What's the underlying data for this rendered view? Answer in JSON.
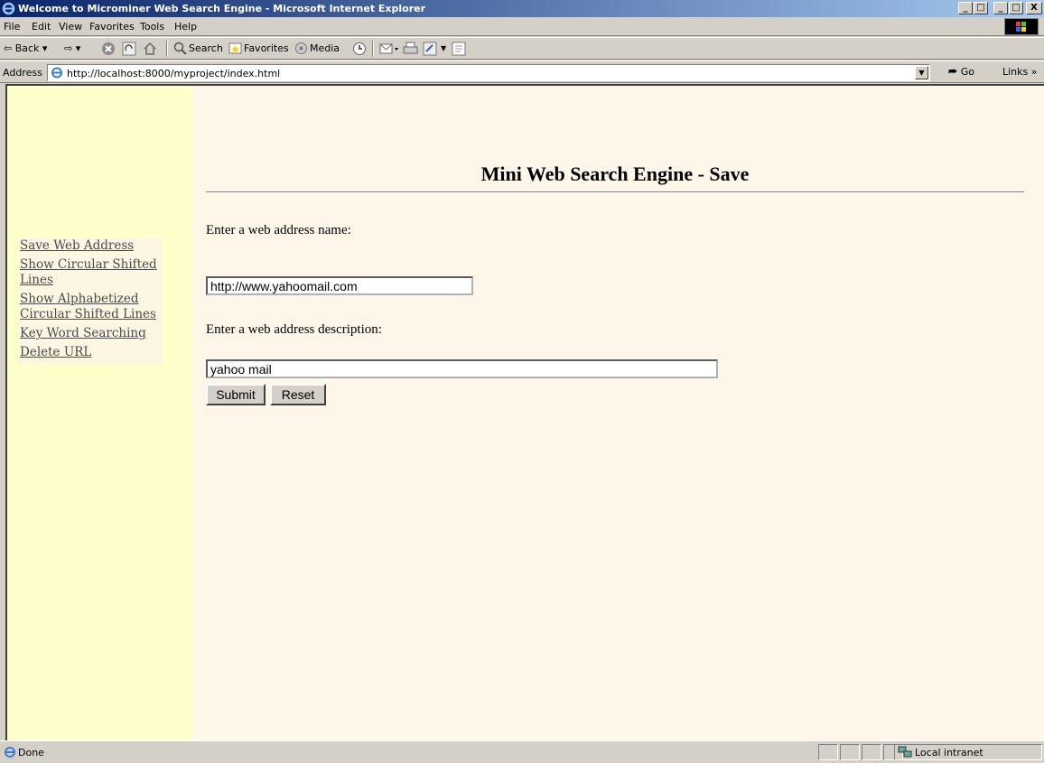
{
  "window": {
    "title": "Welcome to Microminer Web Search Engine - Microsoft Internet Explorer",
    "buttons": [
      "_",
      "□",
      "_",
      "□",
      "X"
    ]
  },
  "menubar": {
    "items": [
      "File",
      "Edit",
      "View",
      "Favorites",
      "Tools",
      "Help"
    ]
  },
  "toolbar": {
    "back": "⇦ Back ▾",
    "forward": "⇨ ▾",
    "search": "Search",
    "favorites": "Favorites",
    "media": "Media"
  },
  "addressbar": {
    "label": "Address",
    "url": "http://localhost:8000/myproject/index.html",
    "go": "Go",
    "links": "Links »"
  },
  "sidebar": {
    "links": [
      "Save Web Address",
      "Show Circular Shifted Lines",
      "Show Alphabetized Circular Shifted Lines",
      "Key Word Searching",
      "Delete URL"
    ]
  },
  "main": {
    "heading": "Mini Web Search Engine - Save",
    "name_label": "Enter a web address name:",
    "name_value": "http://www.yahoomail.com",
    "desc_label": "Enter a web address description:",
    "desc_value": "yahoo mail",
    "submit": "Submit",
    "reset": "Reset"
  },
  "statusbar": {
    "status": "Done",
    "zone": "Local intranet"
  },
  "colors": {
    "title_start": "#0a246a",
    "title_end": "#a6caf0",
    "page_bg": "#fdf6e9",
    "sidebar_bg": "#ffffcc"
  }
}
